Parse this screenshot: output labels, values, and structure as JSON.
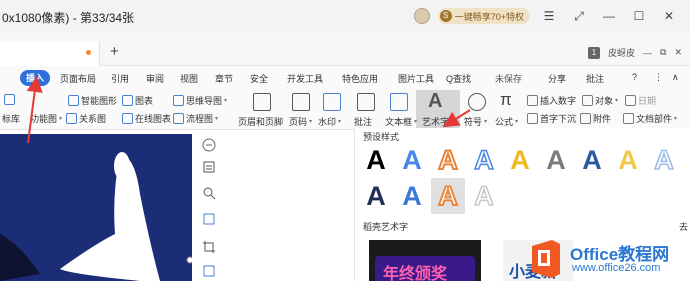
{
  "titlebar": {
    "title": "0x1080像素) - 第33/34张",
    "vip_label": "一键畅享70+特权",
    "vip_badge_letter": "S",
    "window_buttons": [
      "☰",
      "⤢",
      "—",
      "☐",
      "✕"
    ]
  },
  "tabbar": {
    "new_tab": "+",
    "page_badge": "1",
    "username": "皮蚜皮",
    "right_buttons": [
      "—",
      "⧉",
      "✕"
    ]
  },
  "menu": {
    "items": [
      "插入",
      "页面布局",
      "引用",
      "审阅",
      "视图",
      "章节",
      "安全",
      "开发工具",
      "特色应用",
      "图片工具"
    ],
    "search": "Q查找",
    "unsaved": "未保存",
    "share": "分享",
    "comment": "批注",
    "help": "?",
    "more": "⋮",
    "collapse": "∧"
  },
  "ribbon": {
    "row1": [
      "智能图形",
      "图表",
      "思维导图"
    ],
    "row2": [
      "标库",
      "功能图",
      "关系图",
      "在线图表",
      "流程图"
    ],
    "page_header_footer": "页眉和页脚",
    "page_number": "页码",
    "watermark": "水印",
    "comment": "批注",
    "textbox": "文本框",
    "artword": "艺术字",
    "symbol": "符号",
    "formula": "公式",
    "insert_number": "插入数字",
    "object": "对象",
    "date": "日期",
    "first_drop_cap": "首字下沉",
    "attachment": "附件",
    "doc_parts": "文档部件"
  },
  "panel": {
    "preset_label": "预设样式",
    "shell_label": "稻壳艺术字",
    "shell_label_right": "去",
    "artword_glyph": "A",
    "presets_row1_colors": [
      "#000000",
      "#4a86e8",
      "#e8863a",
      "#4a86e8",
      "#f2b820",
      "#7a7a7a",
      "#2c5aa0",
      "#f2c94c",
      "#9bbbe8"
    ],
    "presets_row2_colors": [
      "#1f2f55",
      "#3b78d8",
      "#e8863a",
      "#c8c8c8"
    ],
    "thumb1_text": "年终颁奖",
    "thumb2_text": "小麦新"
  },
  "site_watermark": {
    "line1": "Office教程网",
    "line2": "www.office26.com"
  },
  "colors": {
    "accent": "#2f6fdc",
    "slide_bg": "#1c2d78",
    "arrow": "#e53935",
    "logo_orange": "#f05a22"
  }
}
